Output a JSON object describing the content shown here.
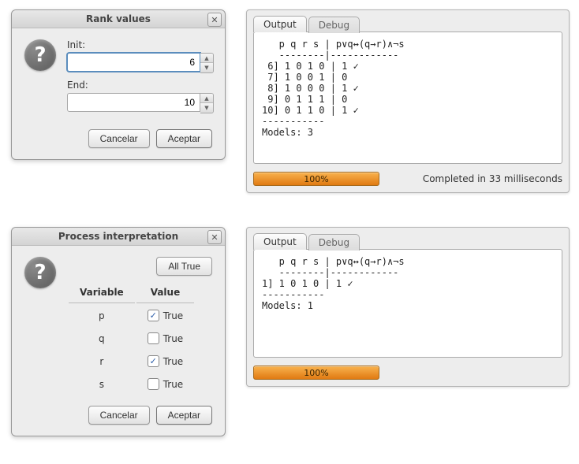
{
  "rank_dialog": {
    "title": "Rank values",
    "init_label": "Init:",
    "init_value": "6",
    "end_label": "End:",
    "end_value": "10",
    "cancel": "Cancelar",
    "accept": "Aceptar"
  },
  "process_dialog": {
    "title": "Process interpretation",
    "all_true": "All True",
    "col_variable": "Variable",
    "col_value": "Value",
    "vars": [
      {
        "name": "p",
        "checked": true,
        "label": "True"
      },
      {
        "name": "q",
        "checked": false,
        "label": "True"
      },
      {
        "name": "r",
        "checked": true,
        "label": "True"
      },
      {
        "name": "s",
        "checked": false,
        "label": "True"
      }
    ],
    "cancel": "Cancelar",
    "accept": "Aceptar"
  },
  "output_top": {
    "tab_output": "Output",
    "tab_debug": "Debug",
    "text": "   p q r s | p∨q↔(q→r)∧¬s\n   --------|------------\n 6] 1 0 1 0 | 1 ✓\n 7] 1 0 0 1 | 0\n 8] 1 0 0 0 | 1 ✓\n 9] 0 1 1 1 | 0\n10] 0 1 1 0 | 1 ✓\n-----------\nModels: 3",
    "progress": "100%",
    "status": "Completed in 33 milliseconds"
  },
  "output_bottom": {
    "tab_output": "Output",
    "tab_debug": "Debug",
    "text": "   p q r s | p∨q↔(q→r)∧¬s\n   --------|------------\n1] 1 0 1 0 | 1 ✓\n-----------\nModels: 1",
    "progress": "100%",
    "status": ""
  }
}
